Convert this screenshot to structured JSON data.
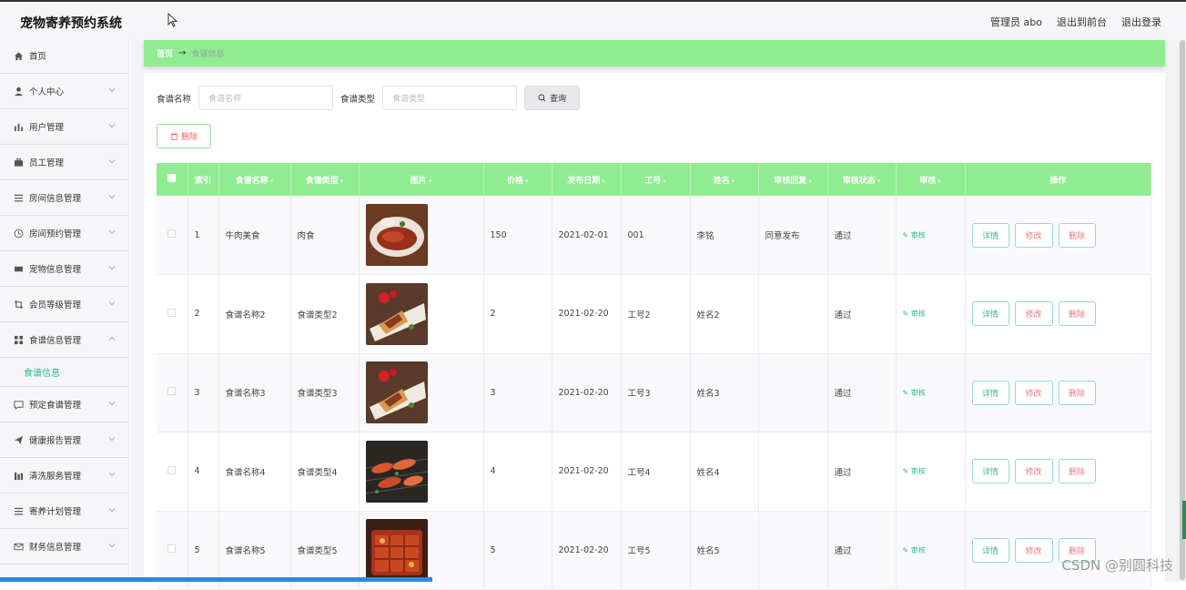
{
  "app": {
    "title": "宠物寄养预约系统"
  },
  "topnav": {
    "admin": "管理员 abo",
    "to_front": "退出到前台",
    "logout": "退出登录"
  },
  "sidebar": {
    "items": [
      {
        "label": "首页",
        "icon": "home-icon"
      },
      {
        "label": "个人中心",
        "icon": "user-icon"
      },
      {
        "label": "用户管理",
        "icon": "bar-chart-icon"
      },
      {
        "label": "员工管理",
        "icon": "briefcase-icon"
      },
      {
        "label": "房间信息管理",
        "icon": "list-icon"
      },
      {
        "label": "房间预约管理",
        "icon": "clock-icon"
      },
      {
        "label": "宠物信息管理",
        "icon": "ticket-icon"
      },
      {
        "label": "会员等级管理",
        "icon": "crop-icon"
      },
      {
        "label": "食谱信息管理",
        "icon": "grid-icon"
      },
      {
        "label": "预定食谱管理",
        "icon": "chat-icon"
      },
      {
        "label": "健康报告管理",
        "icon": "send-icon"
      },
      {
        "label": "清洗服务管理",
        "icon": "columns-icon"
      },
      {
        "label": "寄养计划管理",
        "icon": "list-icon"
      },
      {
        "label": "财务信息管理",
        "icon": "mail-icon"
      }
    ],
    "sub_active": "食谱信息"
  },
  "breadcrumb": {
    "home": "首页",
    "arrow": "→",
    "current": "食谱信息"
  },
  "search": {
    "name_label": "食谱名称",
    "name_placeholder": "食谱名称",
    "type_label": "食谱类型",
    "type_placeholder": "食谱类型",
    "button": "查询"
  },
  "toolbar": {
    "delete_label": "删除"
  },
  "table": {
    "headers": [
      "索引",
      "食谱名称",
      "食谱类型",
      "图片",
      "价格",
      "发布日期",
      "工号",
      "姓名",
      "审核回复",
      "审核状态",
      "审核",
      "操作"
    ],
    "audit_label": "审核",
    "actions": {
      "detail": "详情",
      "edit": "修改",
      "delete": "删除"
    },
    "rows": [
      {
        "index": "1",
        "name": "牛肉美食",
        "type": "肉食",
        "price": "150",
        "date": "2021-02-01",
        "emp_no": "001",
        "emp_name": "李铭",
        "reply": "同意发布",
        "status": "通过"
      },
      {
        "index": "2",
        "name": "食谱名称2",
        "type": "食谱类型2",
        "price": "2",
        "date": "2021-02-20",
        "emp_no": "工号2",
        "emp_name": "姓名2",
        "reply": "",
        "status": "通过"
      },
      {
        "index": "3",
        "name": "食谱名称3",
        "type": "食谱类型3",
        "price": "3",
        "date": "2021-02-20",
        "emp_no": "工号3",
        "emp_name": "姓名3",
        "reply": "",
        "status": "通过"
      },
      {
        "index": "4",
        "name": "食谱名称4",
        "type": "食谱类型4",
        "price": "4",
        "date": "2021-02-20",
        "emp_no": "工号4",
        "emp_name": "姓名4",
        "reply": "",
        "status": "通过"
      },
      {
        "index": "5",
        "name": "食谱名称5",
        "type": "食谱类型5",
        "price": "5",
        "date": "2021-02-20",
        "emp_no": "工号5",
        "emp_name": "姓名5",
        "reply": "",
        "status": "通过"
      }
    ]
  },
  "watermark": "CSDN @别圆科技",
  "colors": {
    "accent_green": "#90ec90",
    "link_teal": "#2bbb8a",
    "danger_red": "#ee6666"
  }
}
